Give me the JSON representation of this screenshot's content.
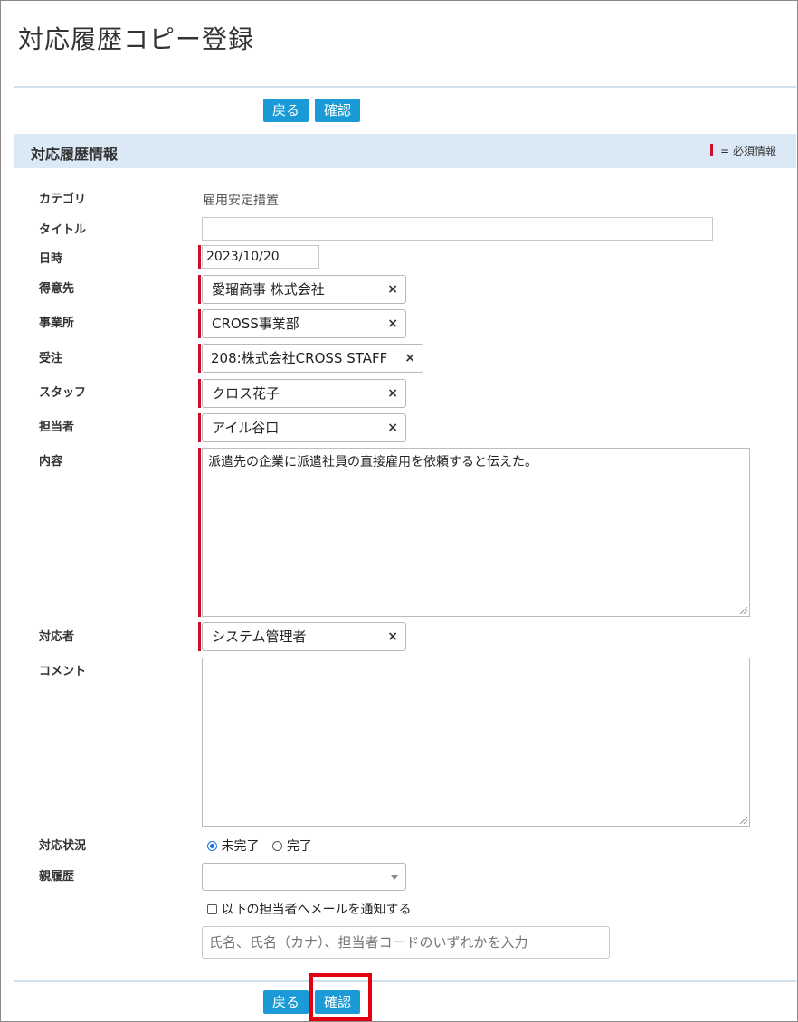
{
  "page": {
    "title": "対応履歴コピー登録"
  },
  "toolbar": {
    "back_label": "戻る",
    "confirm_label": "確認"
  },
  "section": {
    "title": "対応履歴情報",
    "required_legend": "= 必須情報"
  },
  "fields": {
    "category": {
      "label": "カテゴリ",
      "value": "雇用安定措置"
    },
    "title": {
      "label": "タイトル",
      "value": ""
    },
    "datetime": {
      "label": "日時",
      "value": "2023/10/20"
    },
    "customer": {
      "label": "得意先",
      "value": "愛瑠商事 株式会社"
    },
    "office": {
      "label": "事業所",
      "value": "CROSS事業部"
    },
    "order": {
      "label": "受注",
      "value": "208:株式会社CROSS STAFF"
    },
    "staff": {
      "label": "スタッフ",
      "value": "クロス花子"
    },
    "person_in_charge": {
      "label": "担当者",
      "value": "アイル谷口"
    },
    "content": {
      "label": "内容",
      "value": "派遣先の企業に派遣社員の直接雇用を依頼すると伝えた。"
    },
    "handler": {
      "label": "対応者",
      "value": "システム管理者"
    },
    "comment": {
      "label": "コメント",
      "value": ""
    },
    "status": {
      "label": "対応状況",
      "options": [
        "未完了",
        "完了"
      ],
      "selected": "未完了"
    },
    "parent_history": {
      "label": "親履歴",
      "value": ""
    },
    "notify": {
      "label": "以下の担当者へメールを通知する",
      "checked": false
    },
    "notify_search": {
      "placeholder": "氏名、氏名（カナ）、担当者コードのいずれかを入力"
    }
  },
  "remove_glyph": "×",
  "colors": {
    "button": "#1a9bd7",
    "required": "#c8102e",
    "header_bg": "#dbe9f6",
    "highlight": "#e0000f"
  }
}
